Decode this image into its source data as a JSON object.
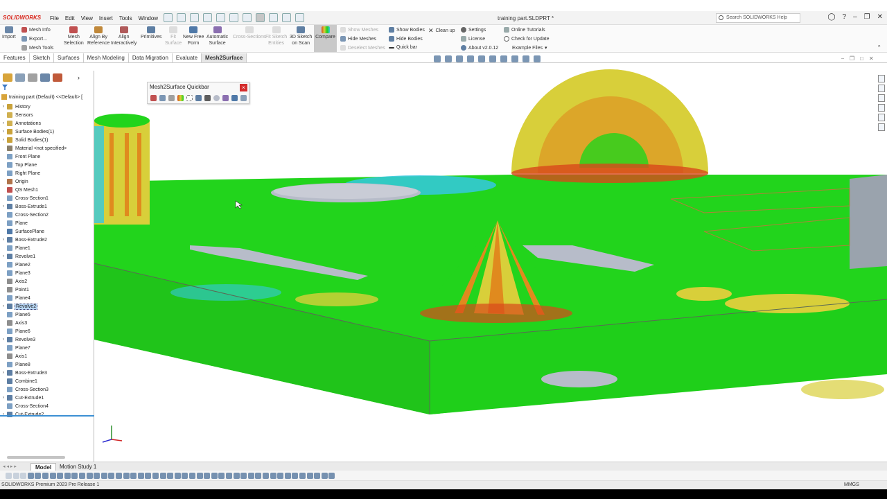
{
  "app": {
    "logo": "SOLIDWORKS",
    "document_title": "training part.SLDPRT *",
    "menu": [
      "File",
      "Edit",
      "View",
      "Insert",
      "Tools",
      "Window"
    ],
    "search_placeholder": "Search SOLIDWORKS Help"
  },
  "ribbon": {
    "import": "Import",
    "mesh_info": "Mesh Info",
    "export": "Export...",
    "mesh_tools": "Mesh Tools",
    "mesh_selection": [
      "Mesh",
      "Selection"
    ],
    "align_by_reference": [
      "Align By",
      "Reference"
    ],
    "align_interactively": [
      "Align",
      "Interactively"
    ],
    "primitives": "Primitives",
    "fit_surface": [
      "Fit",
      "Surface"
    ],
    "new_free_form": [
      "New Free",
      "Form"
    ],
    "automatic_surface": [
      "Automatic",
      "Surface"
    ],
    "cross_sections": "Cross-Sections",
    "fit_sketch_entities": [
      "Fit Sketch",
      "Entities"
    ],
    "sketch_on_scan": [
      "3D Sketch",
      "on Scan"
    ],
    "compare": "Compare",
    "show_meshes": "Show Meshes",
    "hide_meshes": "Hide Meshes",
    "deselect_meshes": "Deselect Meshes",
    "show_bodies": "Show Bodies",
    "hide_bodies": "Hide Bodies",
    "quick_bar": "Quick bar",
    "clean_up": "Clean up",
    "settings": "Settings",
    "license": "License",
    "about": "About v2.0.12",
    "online_tutorials": "Online Tutorials",
    "check_update": "Check for Update",
    "example_files": "Example Files"
  },
  "tabs": [
    "Features",
    "Sketch",
    "Surfaces",
    "Mesh Modeling",
    "Data Migration",
    "Evaluate",
    "Mesh2Surface"
  ],
  "active_tab": "Mesh2Surface",
  "tree": {
    "root": "training part (Default) <<Default> [",
    "items": [
      {
        "label": "History",
        "exp": "›",
        "color": "#c9a23a"
      },
      {
        "label": "Sensors",
        "exp": "",
        "color": "#d0b050"
      },
      {
        "label": "Annotations",
        "exp": "›",
        "color": "#d0b050"
      },
      {
        "label": "Surface Bodies(1)",
        "exp": "›",
        "color": "#c9a23a"
      },
      {
        "label": "Solid Bodies(1)",
        "exp": "›",
        "color": "#c9a23a"
      },
      {
        "label": "Material <not specified>",
        "exp": "",
        "color": "#8a7f6a"
      },
      {
        "label": "Front Plane",
        "exp": "",
        "color": "#7da0c4"
      },
      {
        "label": "Top Plane",
        "exp": "",
        "color": "#7da0c4"
      },
      {
        "label": "Right Plane",
        "exp": "",
        "color": "#7da0c4"
      },
      {
        "label": "Origin",
        "exp": "",
        "color": "#b0734a"
      },
      {
        "label": "QS Mesh1",
        "exp": "",
        "color": "#c05050"
      },
      {
        "label": "Cross-Section1",
        "exp": "",
        "color": "#7da0c4"
      },
      {
        "label": "Boss-Extrude1",
        "exp": "›",
        "color": "#5d7ea3"
      },
      {
        "label": "Cross-Section2",
        "exp": "",
        "color": "#7da0c4"
      },
      {
        "label": "Plane",
        "exp": "",
        "color": "#7da0c4"
      },
      {
        "label": "SurfacePlane",
        "exp": "",
        "color": "#4f79a8"
      },
      {
        "label": "Boss-Extrude2",
        "exp": "›",
        "color": "#5d7ea3"
      },
      {
        "label": "Plane1",
        "exp": "",
        "color": "#7da0c4"
      },
      {
        "label": "Revolve1",
        "exp": "›",
        "color": "#5d7ea3"
      },
      {
        "label": "Plane2",
        "exp": "",
        "color": "#7da0c4"
      },
      {
        "label": "Plane3",
        "exp": "",
        "color": "#7da0c4"
      },
      {
        "label": "Axis2",
        "exp": "",
        "color": "#8e8e8e"
      },
      {
        "label": "Point1",
        "exp": "",
        "color": "#8e8e8e"
      },
      {
        "label": "Plane4",
        "exp": "",
        "color": "#7da0c4"
      },
      {
        "label": "Revolve2",
        "exp": "›",
        "color": "#5d7ea3",
        "selected": true
      },
      {
        "label": "Plane5",
        "exp": "",
        "color": "#7da0c4"
      },
      {
        "label": "Axis3",
        "exp": "",
        "color": "#8e8e8e"
      },
      {
        "label": "Plane6",
        "exp": "",
        "color": "#7da0c4"
      },
      {
        "label": "Revolve3",
        "exp": "›",
        "color": "#5d7ea3"
      },
      {
        "label": "Plane7",
        "exp": "",
        "color": "#7da0c4"
      },
      {
        "label": "Axis1",
        "exp": "",
        "color": "#8e8e8e"
      },
      {
        "label": "Plane8",
        "exp": "",
        "color": "#7da0c4"
      },
      {
        "label": "Boss-Extrude3",
        "exp": "›",
        "color": "#5d7ea3"
      },
      {
        "label": "Combine1",
        "exp": "",
        "color": "#5d7ea3"
      },
      {
        "label": "Cross-Section3",
        "exp": "",
        "color": "#7da0c4"
      },
      {
        "label": "Cut-Extrude1",
        "exp": "›",
        "color": "#5d7ea3"
      },
      {
        "label": "Cross-Section4",
        "exp": "",
        "color": "#7da0c4"
      },
      {
        "label": "Cut-Extrude2",
        "exp": "›",
        "color": "#5d7ea3"
      }
    ]
  },
  "quickbar": {
    "title": "Mesh2Surface Quickbar",
    "close": "×"
  },
  "bottom_tabs": [
    "Model",
    "Motion Study 1"
  ],
  "status": {
    "text": "SOLIDWORKS Premium 2023 Pre Release 1",
    "units": "MMGS"
  },
  "colors": {
    "deviation_green": "#1fcf1a",
    "deviation_yellow": "#d8cf3a",
    "deviation_orange": "#e08a1e",
    "deviation_red": "#d8481a",
    "deviation_cyan": "#35c8e0",
    "hole_gray": "#b7bcc9"
  }
}
